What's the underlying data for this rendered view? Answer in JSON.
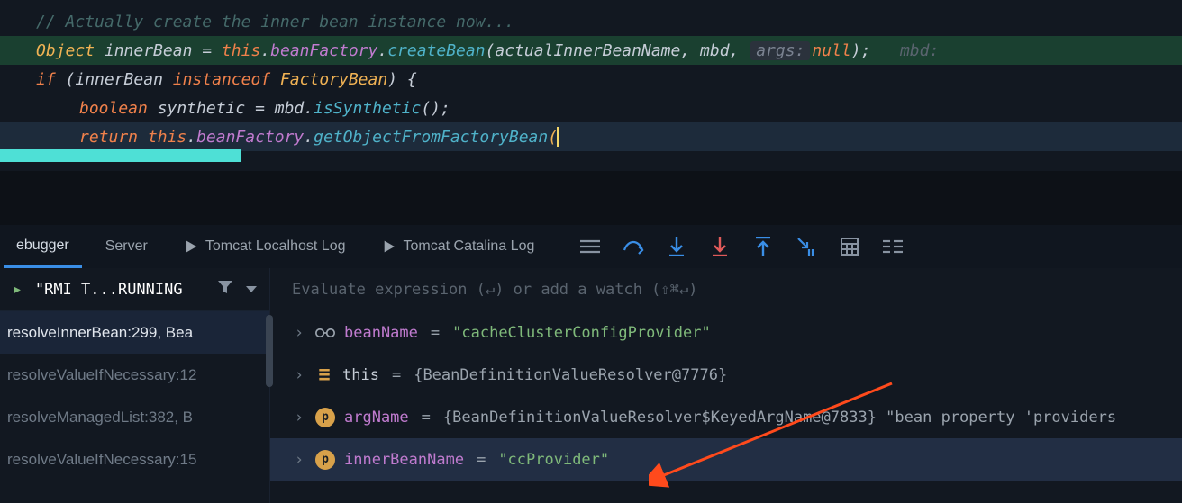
{
  "code": {
    "comment": "// Actually create the inner bean instance now...",
    "line2": {
      "type": "Object",
      "name": "innerBean",
      "assign": " = ",
      "kw_this": "this",
      "dot1": ".",
      "field": "beanFactory",
      "dot2": ".",
      "call": "createBean",
      "open": "(",
      "arg1": "actualInnerBeanName",
      "comma1": ", ",
      "arg2": "mbd",
      "comma2": ", ",
      "hint": "args:",
      "nul": "null",
      "close": ");",
      "inline": "   mbd:"
    },
    "line3": {
      "kw_if": "if",
      "open": " (",
      "ident": "innerBean",
      "instof": " instanceof ",
      "type": "FactoryBean",
      "close": ") {"
    },
    "line4": {
      "type": "boolean",
      "name": " synthetic",
      "assign": " = ",
      "ident": "mbd",
      "dot": ".",
      "call": "isSynthetic",
      "paren": "();"
    },
    "line5": {
      "kw_return": "return ",
      "kw_this": "this",
      "dot": ".",
      "field": "beanFactory",
      "dot2": ".",
      "call": "getObjectFromFactoryBean",
      "paren": "("
    }
  },
  "tabs": {
    "debugger": "ebugger",
    "server": "Server",
    "localhost": "Tomcat Localhost Log",
    "catalina": "Tomcat Catalina Log"
  },
  "toolbar_icons": {
    "layout": "layout-icon",
    "step_over": "step-over-icon",
    "step_into": "step-into-icon",
    "force_into": "force-step-into-icon",
    "step_out": "step-out-icon",
    "run_to": "run-to-cursor-icon",
    "evaluate": "evaluate-icon",
    "trace": "trace-icon"
  },
  "frames": {
    "thread": "\"RMI T...RUNNING",
    "items": [
      "resolveInnerBean:299, Bea",
      "resolveValueIfNecessary:12",
      "resolveManagedList:382, B",
      "resolveValueIfNecessary:15"
    ]
  },
  "watch": {
    "placeholder": "Evaluate expression (↵) or add a watch (⇧⌘↵)"
  },
  "vars": [
    {
      "icon": "glasses",
      "name": "beanName",
      "value": "\"cacheClusterConfigProvider\"",
      "kind": "str"
    },
    {
      "icon": "obj",
      "name": "this",
      "value": "{BeanDefinitionValueResolver@7776}",
      "kind": "obj"
    },
    {
      "icon": "p",
      "name": "argName",
      "value": "{BeanDefinitionValueResolver$KeyedArgName@7833} \"bean property 'providers",
      "kind": "obj"
    },
    {
      "icon": "p",
      "name": "innerBeanName",
      "value": "\"ccProvider\"",
      "kind": "str",
      "selected": true
    }
  ]
}
